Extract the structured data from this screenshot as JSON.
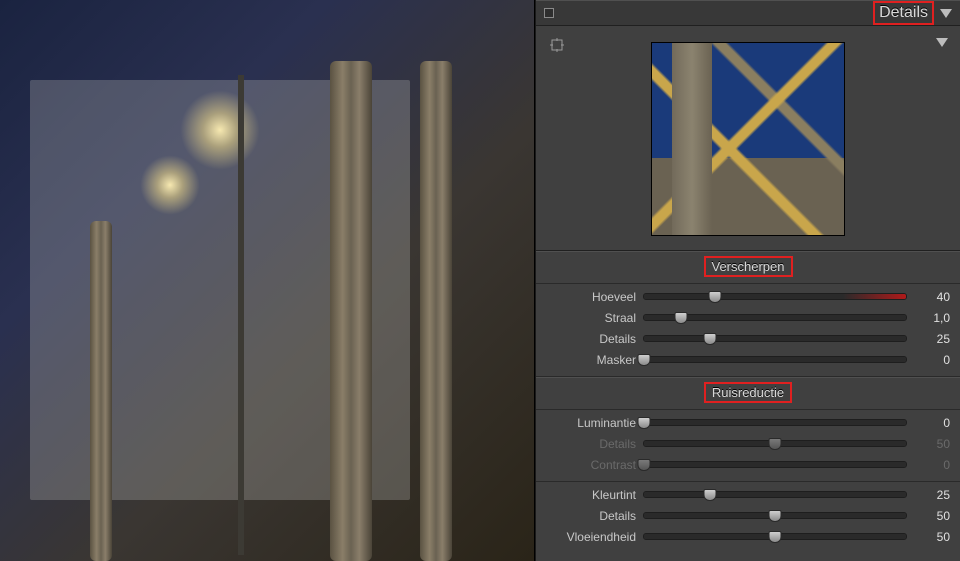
{
  "panel": {
    "title": "Details",
    "sections": {
      "sharpen": {
        "title": "Verscherpen",
        "sliders": {
          "amount": {
            "label": "Hoeveel",
            "value": "40",
            "percent": 27,
            "red_tail": true
          },
          "radius": {
            "label": "Straal",
            "value": "1,0",
            "percent": 14
          },
          "detail": {
            "label": "Details",
            "value": "25",
            "percent": 25
          },
          "mask": {
            "label": "Masker",
            "value": "0",
            "percent": 0
          }
        }
      },
      "noise": {
        "title": "Ruisreductie",
        "groups": {
          "luminance": {
            "lum": {
              "label": "Luminantie",
              "value": "0",
              "percent": 0
            },
            "detail": {
              "label": "Details",
              "value": "50",
              "percent": 50,
              "disabled": true
            },
            "contrast": {
              "label": "Contrast",
              "value": "0",
              "percent": 0,
              "disabled": true
            }
          },
          "color": {
            "tint": {
              "label": "Kleurtint",
              "value": "25",
              "percent": 25
            },
            "detail": {
              "label": "Details",
              "value": "50",
              "percent": 50
            },
            "smooth": {
              "label": "Vloeiendheid",
              "value": "50",
              "percent": 50
            }
          }
        }
      }
    }
  }
}
